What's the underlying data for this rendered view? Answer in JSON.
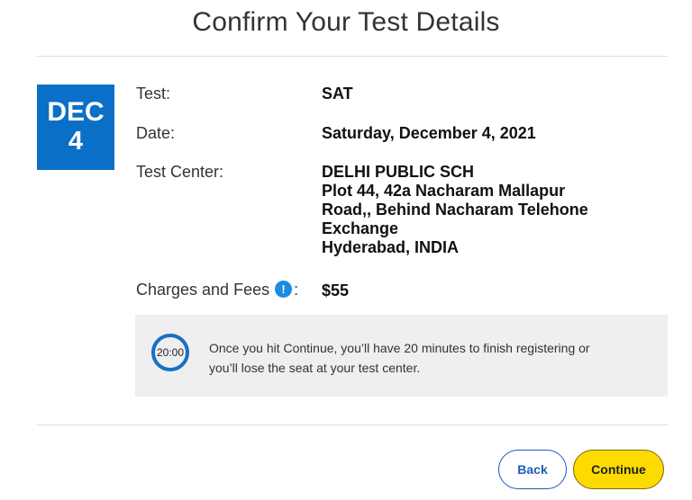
{
  "page": {
    "title": "Confirm Your Test Details"
  },
  "badge": {
    "month": "DEC",
    "day": "4",
    "color": "#0a6fc7"
  },
  "details": {
    "test_label": "Test:",
    "test_value": "SAT",
    "date_label": "Date:",
    "date_value": "Saturday, December 4, 2021",
    "center_label": "Test Center:",
    "center_lines": [
      "DELHI PUBLIC SCH",
      "Plot 44, 42a Nacharam Mallapur",
      "Road,, Behind Nacharam Telehone",
      "Exchange",
      "Hyderabad, INDIA"
    ],
    "fees_label": "Charges and Fees",
    "fees_info_icon": "!",
    "fees_colon": ":",
    "fees_value": "$55"
  },
  "notice": {
    "timer": "20:00",
    "text_line1": "Once you hit Continue, you’ll have 20 minutes to finish registering or",
    "text_line2": "you’ll lose the seat at your test center."
  },
  "buttons": {
    "back": "Back",
    "continue": "Continue",
    "continue_color": "#fedb00"
  }
}
